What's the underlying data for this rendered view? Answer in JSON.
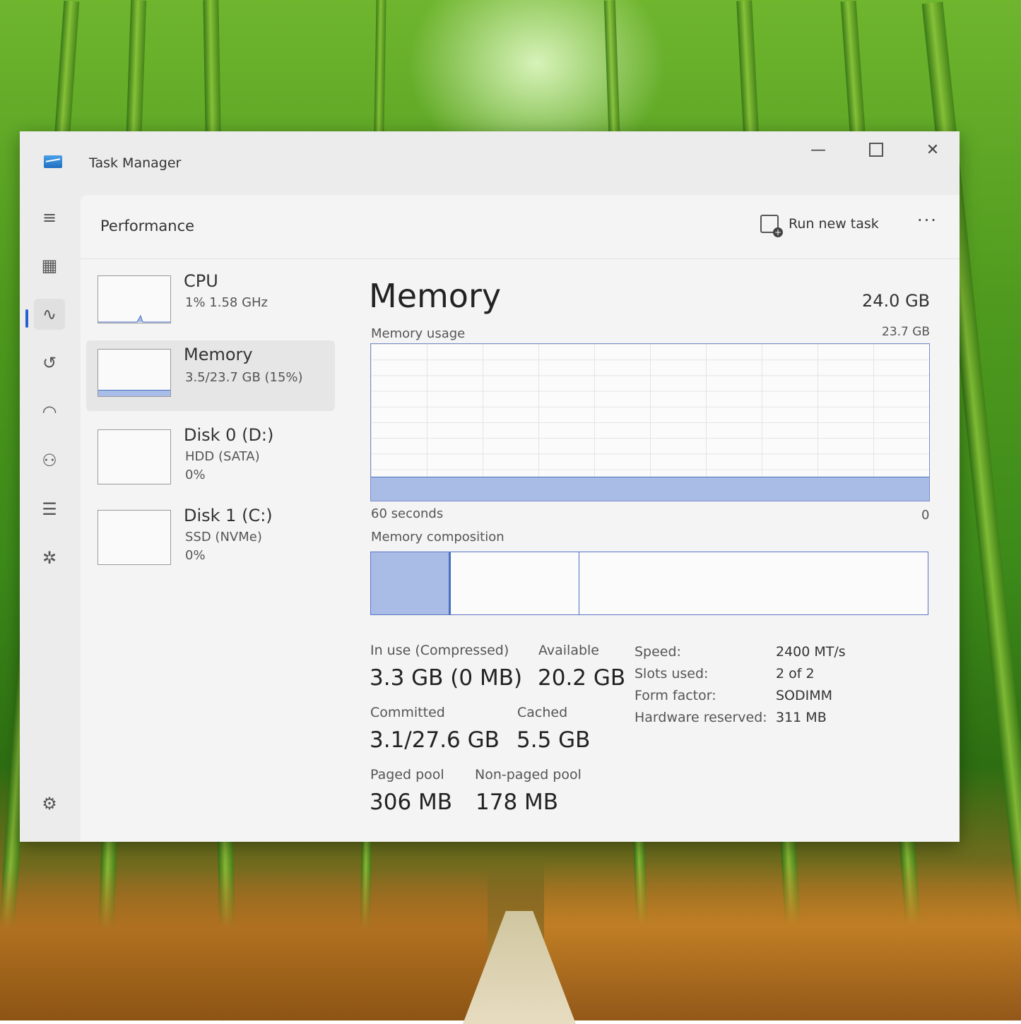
{
  "window": {
    "title": "Task Manager",
    "minimize": "—",
    "close": "✕"
  },
  "nav": {
    "menu_icon": "hamburger-menu-icon",
    "items": [
      {
        "name": "processes",
        "icon": "processes-icon",
        "glyph": "▦"
      },
      {
        "name": "performance",
        "icon": "performance-icon",
        "glyph": "∿"
      },
      {
        "name": "app-history",
        "icon": "history-icon",
        "glyph": "↺"
      },
      {
        "name": "startup-apps",
        "icon": "startup-icon",
        "glyph": "◠"
      },
      {
        "name": "users",
        "icon": "users-icon",
        "glyph": "⚇"
      },
      {
        "name": "details",
        "icon": "details-list-icon",
        "glyph": "☰"
      },
      {
        "name": "services",
        "icon": "services-icon",
        "glyph": "✲"
      }
    ],
    "settings_icon": "gear-icon",
    "settings_glyph": "⚙",
    "menu_glyph": "≡"
  },
  "header": {
    "title": "Performance",
    "run_new_task": "Run new task",
    "more": "···"
  },
  "resources": [
    {
      "name": "CPU",
      "sub1": "1%  1.58 GHz",
      "sub2": "",
      "sub3": ""
    },
    {
      "name": "Memory",
      "sub1": "3.5/23.7 GB (15%)",
      "sub2": "",
      "sub3": ""
    },
    {
      "name": "Disk 0 (D:)",
      "sub1": "HDD (SATA)",
      "sub2": "0%",
      "sub3": ""
    },
    {
      "name": "Disk 1 (C:)",
      "sub1": "SSD (NVMe)",
      "sub2": "0%",
      "sub3": ""
    }
  ],
  "memory": {
    "title": "Memory",
    "total": "24.0 GB",
    "usage_label": "Memory usage",
    "usage_max": "23.7 GB",
    "usage_fraction": 0.15,
    "graph_left_label": "60 seconds",
    "graph_right_label": "0",
    "composition_label": "Memory composition",
    "composition": {
      "in_use_fraction": 0.14,
      "modified_fraction": 0.0,
      "standby_fraction": 0.23
    },
    "stats": {
      "in_use_label": "In use (Compressed)",
      "in_use_value": "3.3 GB (0 MB)",
      "available_label": "Available",
      "available_value": "20.2 GB",
      "committed_label": "Committed",
      "committed_value": "3.1/27.6 GB",
      "cached_label": "Cached",
      "cached_value": "5.5 GB",
      "paged_label": "Paged pool",
      "paged_value": "306 MB",
      "nonpaged_label": "Non-paged pool",
      "nonpaged_value": "178 MB"
    },
    "specs": {
      "speed_label": "Speed:",
      "speed_value": "2400 MT/s",
      "slots_label": "Slots used:",
      "slots_value": "2 of 2",
      "form_label": "Form factor:",
      "form_value": "SODIMM",
      "hw_label": "Hardware reserved:",
      "hw_value": "311 MB"
    }
  },
  "colors": {
    "accent": "#2a5fd0",
    "graph_fill": "#a9bce6",
    "graph_line": "#4a6fc0"
  }
}
